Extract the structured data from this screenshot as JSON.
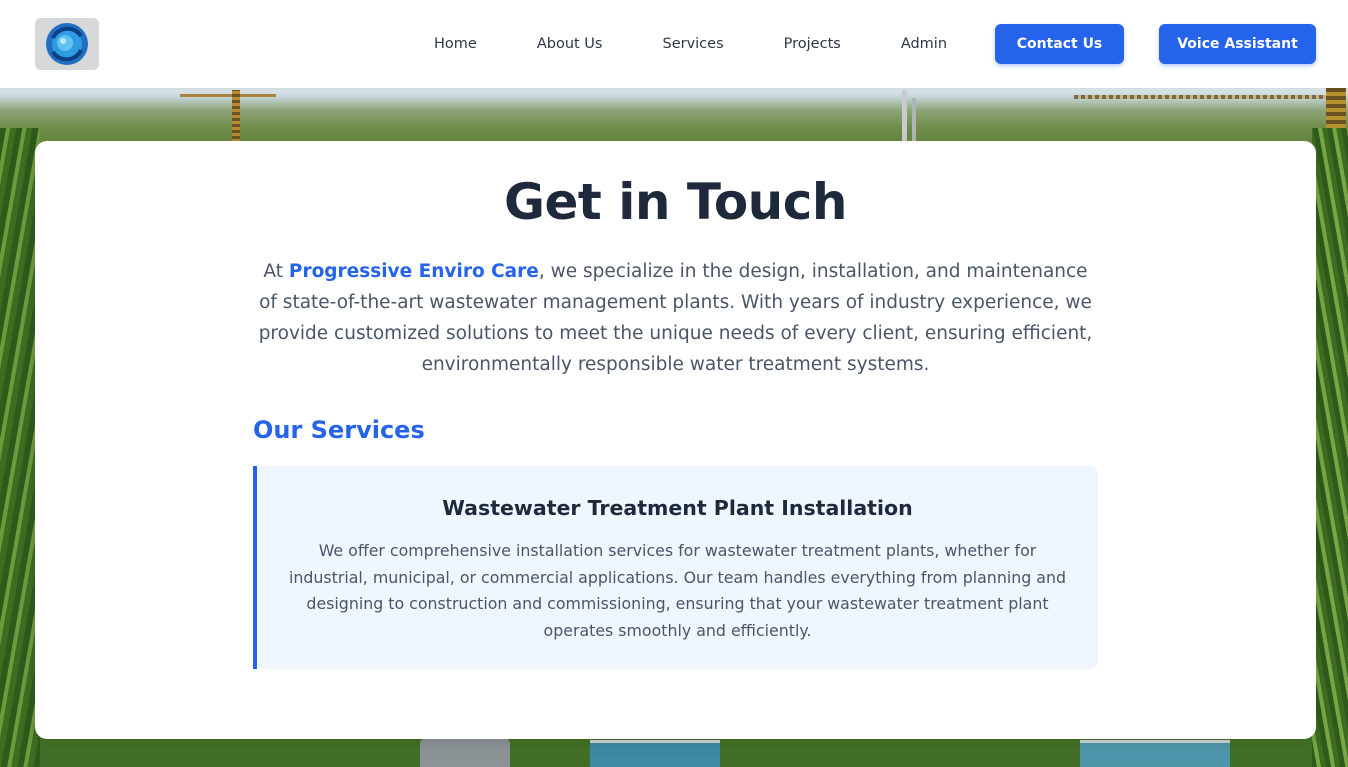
{
  "header": {
    "logo_icon": "circular-water-logo-icon",
    "nav": {
      "home": "Home",
      "about": "About Us",
      "services": "Services",
      "projects": "Projects",
      "admin": "Admin"
    },
    "contact_label": "Contact Us",
    "voice_label": "Voice Assistant"
  },
  "main": {
    "title": "Get in Touch",
    "intro_prefix": "At ",
    "brand": "Progressive Enviro Care",
    "intro_rest": ", we specialize in the design, installation, and maintenance of state-of-the-art wastewater management plants. With years of industry experience, we provide customized solutions to meet the unique needs of every client, ensuring efficient, environmentally responsible water treatment systems.",
    "services_heading": "Our Services",
    "service": {
      "title": "Wastewater Treatment Plant Installation",
      "description": "We offer comprehensive installation services for wastewater treatment plants, whether for industrial, municipal, or commercial applications. Our team handles everything from planning and designing to construction and commissioning, ensuring that your wastewater treatment plant operates smoothly and efficiently."
    }
  },
  "colors": {
    "accent": "#2563eb",
    "heading": "#1e293b",
    "body_text": "#4a5568",
    "service_bg": "#eff6ff"
  }
}
